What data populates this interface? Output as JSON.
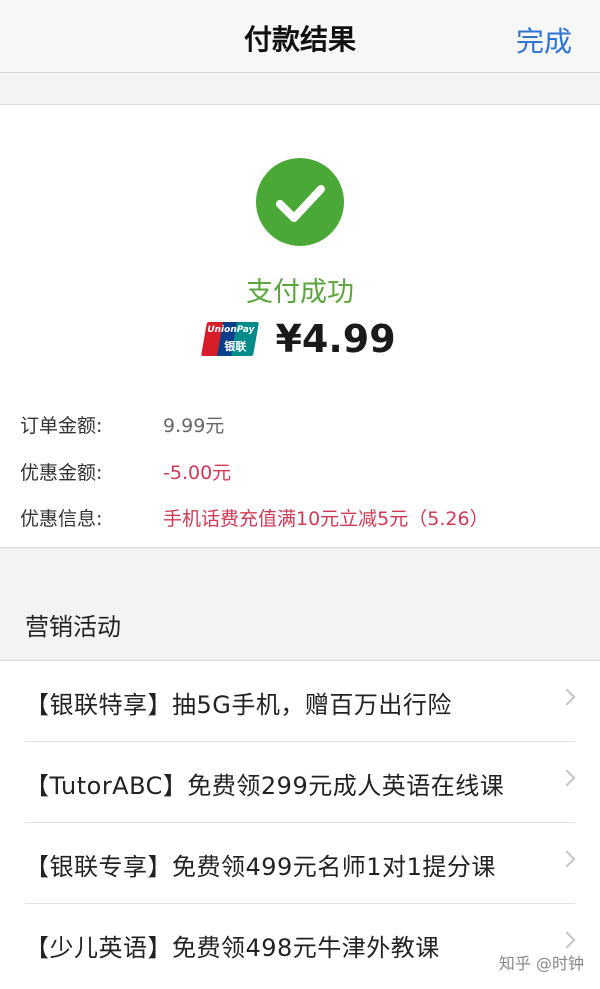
{
  "navbar": {
    "title": "付款结果",
    "done_label": "完成"
  },
  "result": {
    "status_text": "支付成功",
    "payment_logo_text": "UnionPay",
    "payment_logo_text_cn": "银联",
    "amount": "¥4.99",
    "colors": {
      "success": "#4aa936",
      "unionpay_red": "#d71e28",
      "unionpay_blue": "#0b3f8c",
      "unionpay_teal": "#008b8b"
    }
  },
  "details": [
    {
      "label": "订单金额:",
      "value": "9.99元"
    },
    {
      "label": "优惠金额:",
      "value": "-5.00元"
    },
    {
      "label": "优惠信息:",
      "value": "手机话费充值满10元立减5元（5.26）"
    }
  ],
  "marketing": {
    "title": "营销活动",
    "items": [
      {
        "label": "【银联特享】抽5G手机，赠百万出行险"
      },
      {
        "label": "【TutorABC】免费领299元成人英语在线课"
      },
      {
        "label": "【银联专享】免费领499元名师1对1提分课"
      },
      {
        "label": "【少儿英语】免费领498元牛津外教课"
      }
    ]
  },
  "watermark": "知乎 @时钟"
}
